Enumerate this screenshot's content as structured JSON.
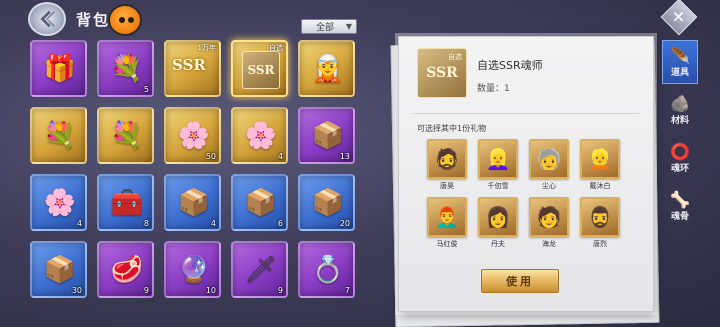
{
  "header": {
    "title": "背包",
    "filter_value": "全部"
  },
  "inventory": [
    {
      "art": "🎁",
      "color": "purple",
      "qty": ""
    },
    {
      "art": "💐",
      "color": "purple",
      "qty": "5"
    },
    {
      "art": "SSR",
      "color": "gold",
      "qty": "",
      "tag": "1万年",
      "kind": "ssr-item"
    },
    {
      "art": "SSR",
      "color": "gold",
      "qty": "",
      "tag": "自选",
      "kind": "ssr-box",
      "selected": true
    },
    {
      "art": "🧝",
      "color": "gold",
      "qty": ""
    },
    {
      "art": "",
      "color": "none"
    },
    {
      "art": "💐",
      "color": "gold",
      "qty": ""
    },
    {
      "art": "💐",
      "color": "gold",
      "qty": ""
    },
    {
      "art": "🌸",
      "color": "gold",
      "qty": "50"
    },
    {
      "art": "🌸",
      "color": "gold",
      "qty": "4"
    },
    {
      "art": "📦",
      "color": "purple",
      "qty": "13"
    },
    {
      "art": "",
      "color": "none"
    },
    {
      "art": "🌸",
      "color": "blue",
      "qty": "4"
    },
    {
      "art": "🧰",
      "color": "blue",
      "qty": "8"
    },
    {
      "art": "📦",
      "color": "blue",
      "qty": "4"
    },
    {
      "art": "📦",
      "color": "blue",
      "qty": "6"
    },
    {
      "art": "📦",
      "color": "blue",
      "qty": "20"
    },
    {
      "art": "",
      "color": "none"
    },
    {
      "art": "📦",
      "color": "blue",
      "qty": "30"
    },
    {
      "art": "🥩",
      "color": "purple",
      "qty": "9"
    },
    {
      "art": "🔮",
      "color": "purple",
      "qty": "10"
    },
    {
      "art": "🗡",
      "color": "purple",
      "qty": "9"
    },
    {
      "art": "💍",
      "color": "purple",
      "qty": "7"
    }
  ],
  "detail": {
    "icon_text": "SSR",
    "icon_tag": "自选",
    "name": "自选SSR魂师",
    "quantity": "数量：1",
    "choose_label": "可选择其中1份礼物",
    "heroes": [
      {
        "name": "唐昊",
        "icon": "🧔"
      },
      {
        "name": "千仞雪",
        "icon": "👱‍♀️"
      },
      {
        "name": "尘心",
        "icon": "🧓"
      },
      {
        "name": "戴沐白",
        "icon": "👱"
      },
      {
        "name": "马红俊",
        "icon": "👨‍🦰"
      },
      {
        "name": "丹夫",
        "icon": "👩"
      },
      {
        "name": "海龙",
        "icon": "🧑"
      },
      {
        "name": "唐烈",
        "icon": "🧔‍♂️"
      }
    ],
    "use_button": "使用"
  },
  "tabs": [
    {
      "label": "道具",
      "icon": "🪶",
      "active": true
    },
    {
      "label": "材料",
      "icon": "🪨",
      "active": false
    },
    {
      "label": "魂环",
      "icon": "⭕",
      "active": false
    },
    {
      "label": "魂骨",
      "icon": "🦴",
      "active": false
    }
  ],
  "colors": {
    "accent": "#2a4fa8",
    "gold": "#d5a43b",
    "purple": "#8a3cc4",
    "blue": "#3e6fd0"
  }
}
